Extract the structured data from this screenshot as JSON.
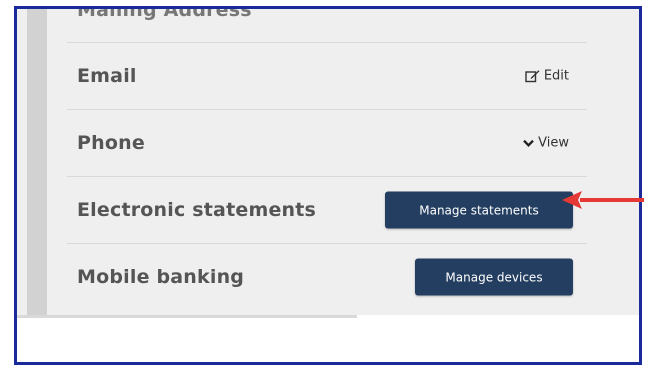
{
  "rows": [
    {
      "label": "Mailing Address",
      "action": ""
    },
    {
      "label": "Email",
      "action": "Edit",
      "action_icon": "edit-icon"
    },
    {
      "label": "Phone",
      "action": "View",
      "action_icon": "chevron-down-icon"
    },
    {
      "label": "Electronic statements",
      "action": "Manage statements"
    },
    {
      "label": "Mobile banking",
      "action": "Manage devices"
    }
  ],
  "colors": {
    "frame_border": "#1b2a9a",
    "button_bg": "#233e60",
    "arrow": "#e53935",
    "panel_bg": "#efefef"
  }
}
